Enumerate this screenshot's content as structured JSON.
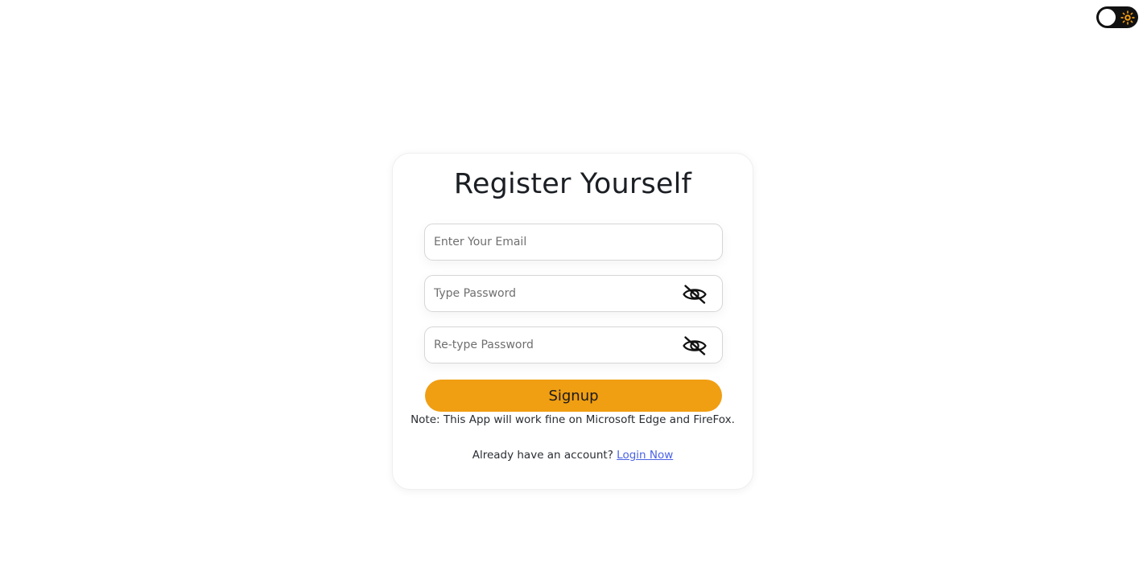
{
  "theme_toggle": {
    "icon": "sun-icon",
    "colors": {
      "track": "#111111",
      "knob": "#ffffff",
      "sun": "#f59e0b"
    }
  },
  "form": {
    "title": "Register Yourself",
    "email_placeholder": "Enter Your Email",
    "password_placeholder": "Type Password",
    "retype_password_placeholder": "Re-type Password",
    "password_visibility_icon": "eye-off-icon",
    "signup_label": "Signup",
    "note": "Note: This App will work fine on Microsoft Edge and FireFox.",
    "account_prompt": "Already have an account?",
    "login_link": "Login Now"
  },
  "colors": {
    "accent": "#f09e12",
    "link": "#4a63e6"
  }
}
